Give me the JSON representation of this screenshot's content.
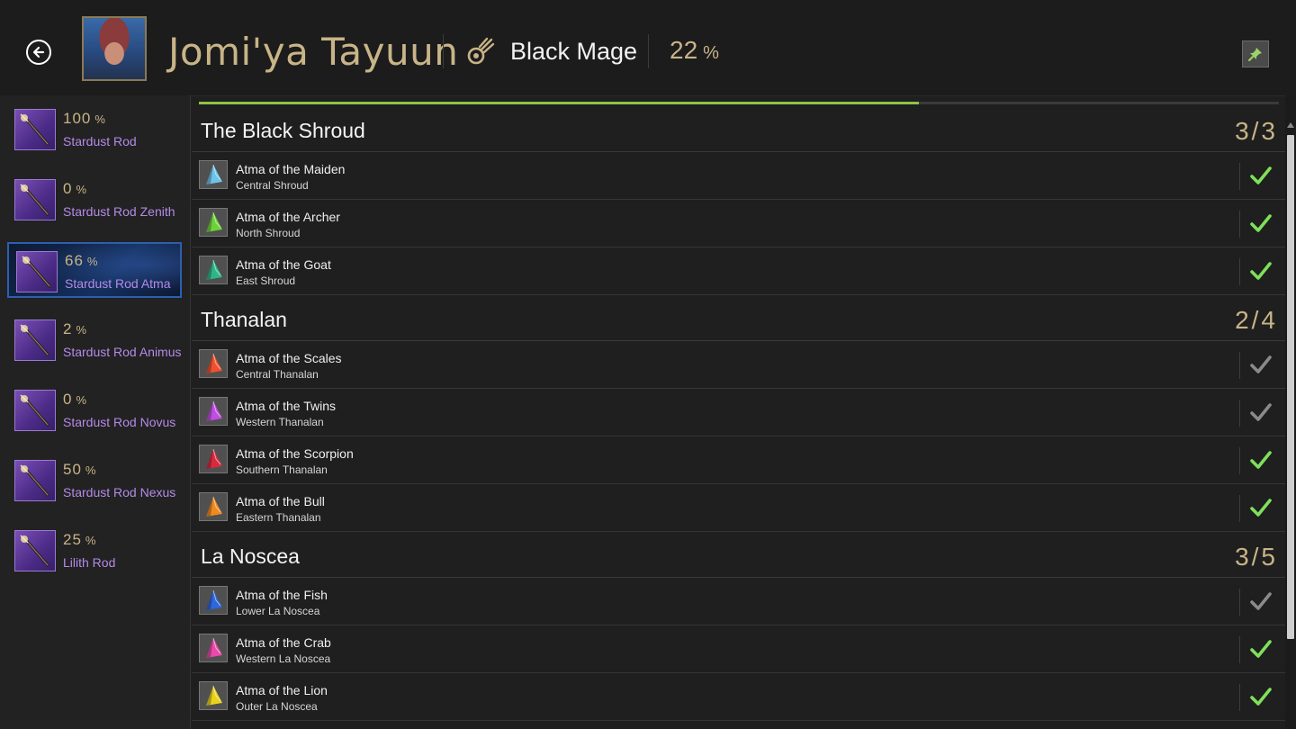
{
  "header": {
    "character_name": "Jomi'ya Tayuun",
    "job_name": "Black Mage",
    "job_icon": "black-mage-job-icon",
    "job_progress": "22",
    "percent_symbol": "%"
  },
  "weapons": [
    {
      "percent": "100",
      "name": "Stardust Rod",
      "selected": false
    },
    {
      "percent": "0",
      "name": "Stardust Rod Zenith",
      "selected": false
    },
    {
      "percent": "66",
      "name": "Stardust Rod Atma",
      "selected": true
    },
    {
      "percent": "2",
      "name": "Stardust Rod Animus",
      "selected": false
    },
    {
      "percent": "0",
      "name": "Stardust Rod Novus",
      "selected": false
    },
    {
      "percent": "50",
      "name": "Stardust Rod Nexus",
      "selected": false
    },
    {
      "percent": "25",
      "name": "Lilith Rod",
      "selected": false
    }
  ],
  "main": {
    "progress_fraction": 0.66,
    "regions": [
      {
        "name": "The Black Shroud",
        "count": "3/3",
        "items": [
          {
            "name": "Atma of the Maiden",
            "location": "Central Shroud",
            "done": true,
            "color": "#6fc3e8"
          },
          {
            "name": "Atma of the Archer",
            "location": "North Shroud",
            "done": true,
            "color": "#6fd13a"
          },
          {
            "name": "Atma of the Goat",
            "location": "East Shroud",
            "done": true,
            "color": "#2fb58a"
          }
        ]
      },
      {
        "name": "Thanalan",
        "count": "2/4",
        "items": [
          {
            "name": "Atma of the Scales",
            "location": "Central Thanalan",
            "done": false,
            "color": "#f0502e"
          },
          {
            "name": "Atma of the Twins",
            "location": "Western Thanalan",
            "done": false,
            "color": "#c04ee0"
          },
          {
            "name": "Atma of the Scorpion",
            "location": "Southern Thanalan",
            "done": true,
            "color": "#d62b3f"
          },
          {
            "name": "Atma of the Bull",
            "location": "Eastern Thanalan",
            "done": true,
            "color": "#f08a20"
          }
        ]
      },
      {
        "name": "La Noscea",
        "count": "3/5",
        "items": [
          {
            "name": "Atma of the Fish",
            "location": "Lower La Noscea",
            "done": false,
            "color": "#2f66d8"
          },
          {
            "name": "Atma of the Crab",
            "location": "Western La Noscea",
            "done": true,
            "color": "#e84aa8"
          },
          {
            "name": "Atma of the Lion",
            "location": "Outer La Noscea",
            "done": true,
            "color": "#e8d21c"
          }
        ]
      }
    ]
  },
  "colors": {
    "gold": "#c8b487",
    "check_done": "#7fe05a",
    "check_pending": "#8a8a8a",
    "weapon_name": "#b58ae8",
    "progress": "#8fc443"
  }
}
